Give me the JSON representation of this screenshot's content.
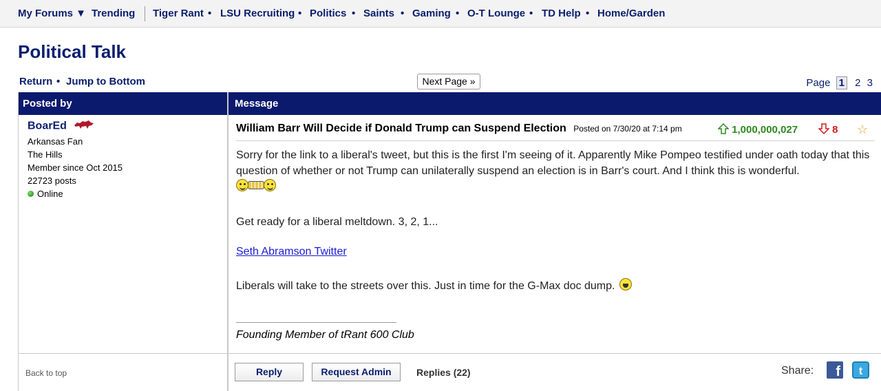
{
  "topnav": {
    "my_forums": "My Forums ▼",
    "trending": "Trending",
    "items": [
      "Tiger Rant",
      "LSU Recruiting",
      "Politics",
      "Saints",
      "Gaming",
      "O-T Lounge",
      "TD Help",
      "Home/Garden"
    ],
    "dot": "•"
  },
  "page_title": "Political Talk",
  "subnav": {
    "return": "Return",
    "dot": "•",
    "jump": "Jump to Bottom",
    "next_page": "Next Page »"
  },
  "pager": {
    "label": "Page",
    "current": "1",
    "pages": [
      "2",
      "3"
    ]
  },
  "table": {
    "col_posted_by": "Posted by",
    "col_message": "Message"
  },
  "user": {
    "name": "BoarEd",
    "fan": "Arkansas Fan",
    "location": "The Hills",
    "member_since": "Member since Oct 2015",
    "posts": "22723 posts",
    "status": "Online"
  },
  "post": {
    "title": "William Barr Will Decide if Donald Trump can Suspend Election",
    "posted": "Posted on 7/30/20 at 7:14 pm",
    "upvotes": "1,000,000,027",
    "downvotes": "8",
    "p1": "Sorry for the link to a liberal's tweet, but this is the first I'm seeing of it. Apparently Mike Pompeo testified under oath today that this question of whether or not Trump can unilaterally suspend an election is in Barr's court. And I think this is wonderful.",
    "p2": "Get ready for a liberal meltdown. 3, 2, 1...",
    "link": "Seth Abramson Twitter",
    "p3": "Liberals will take to the streets over this. Just in time for the G-Max doc dump.",
    "signature": "Founding Member of tRant 600 Club"
  },
  "footer": {
    "back_to_top": "Back to top",
    "reply": "Reply",
    "request_admin": "Request Admin",
    "replies": "Replies (22)",
    "share": "Share:",
    "fb": "f",
    "tw": "t"
  },
  "colors": {
    "navy": "#0c1a6e",
    "link_navy": "#0a1e6e",
    "upvote_green": "#2d8a1e",
    "downvote_red": "#d21a1a"
  }
}
